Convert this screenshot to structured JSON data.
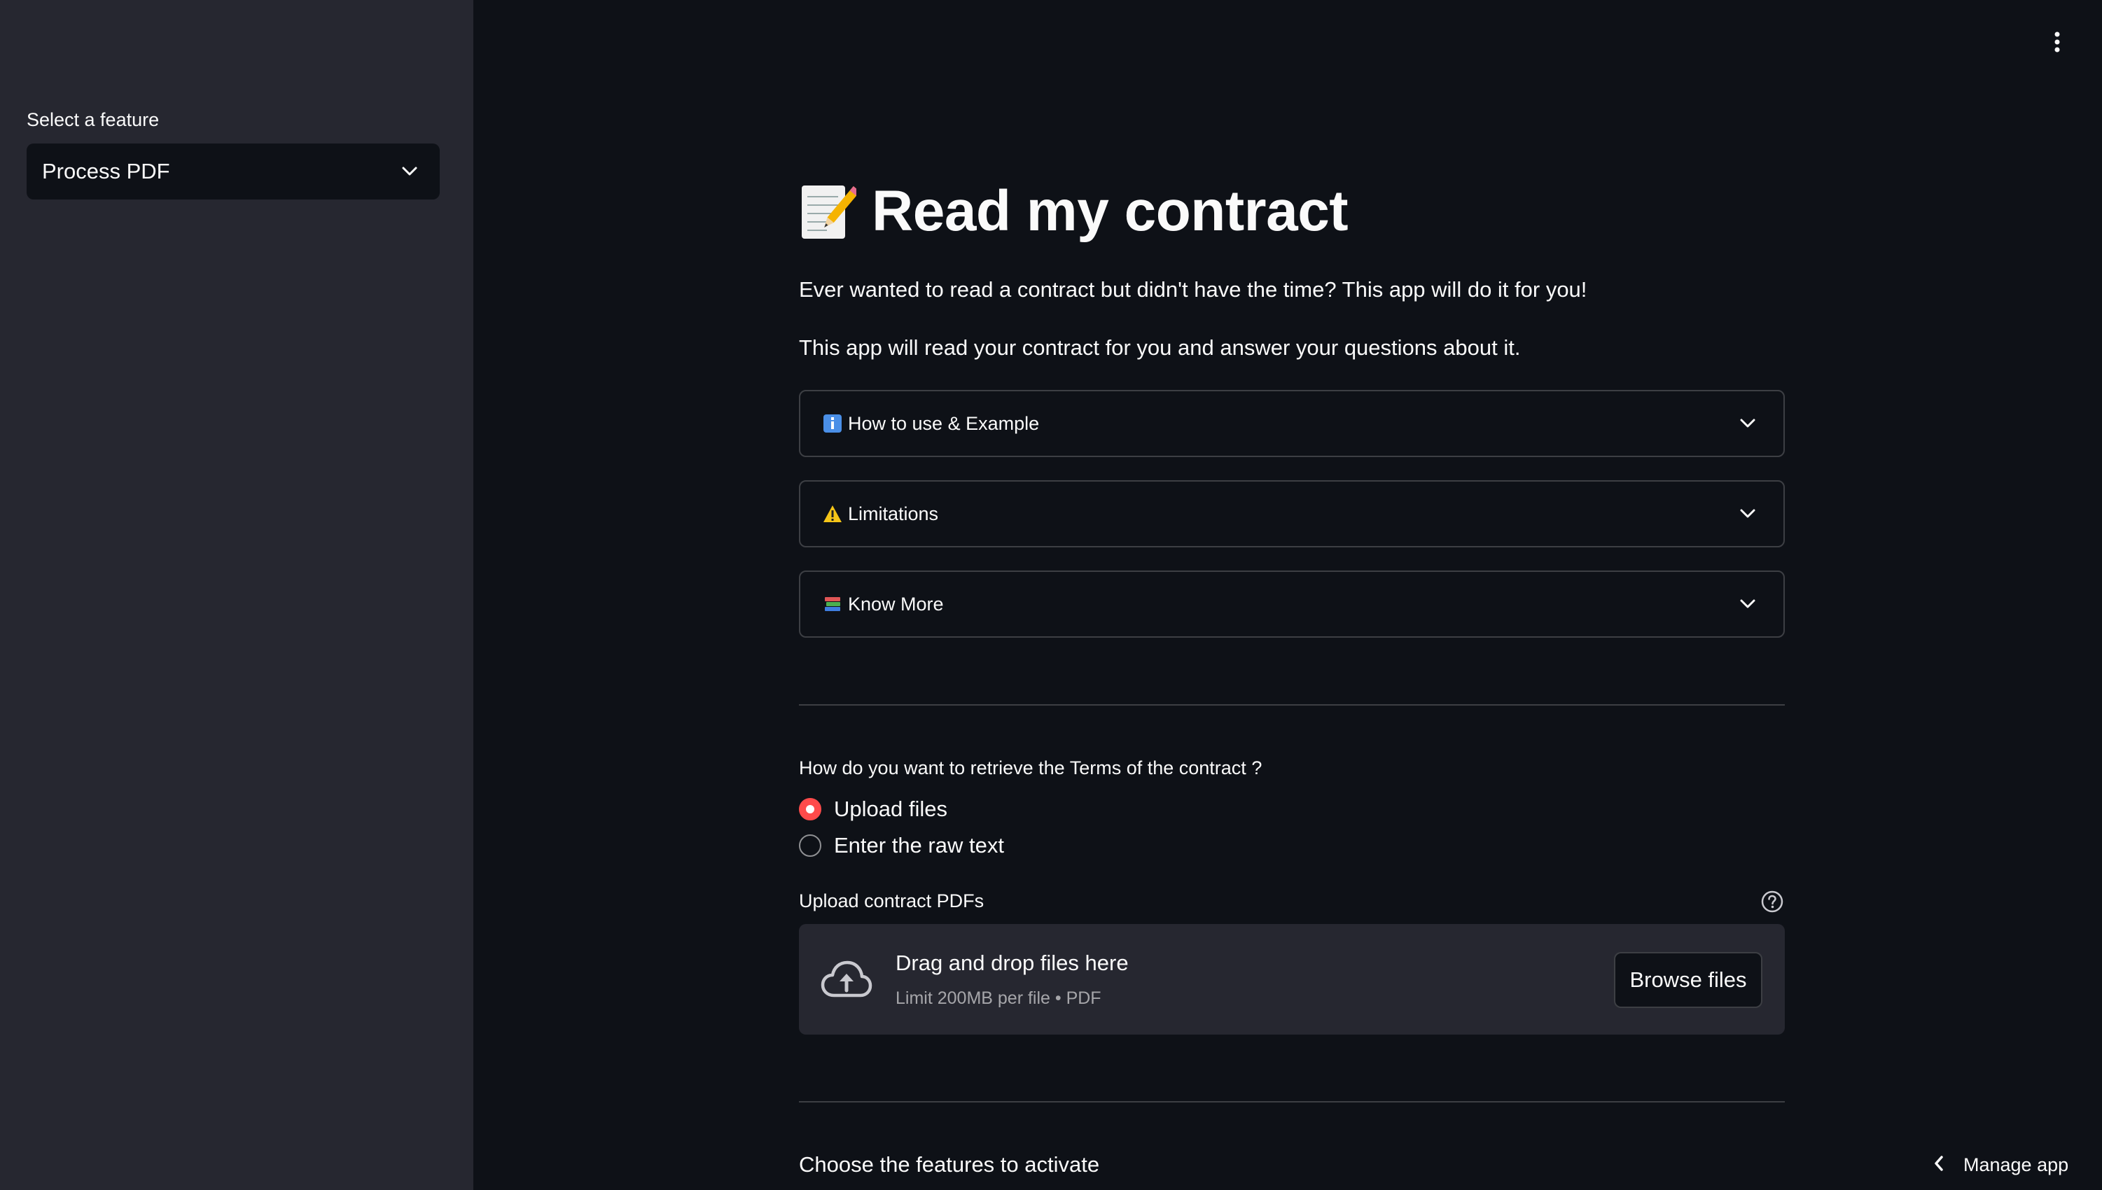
{
  "sidebar": {
    "select_label": "Select a feature",
    "select_value": "Process PDF"
  },
  "main": {
    "title": "Read my contract",
    "title_icon": "memo-icon",
    "intro_1": "Ever wanted to read a contract but didn't have the time? This app will do it for you!",
    "intro_2": "This app will read your contract for you and answer your questions about it.",
    "expanders": [
      {
        "label": "How to use & Example",
        "icon": "info-icon"
      },
      {
        "label": "Limitations",
        "icon": "warning-icon"
      },
      {
        "label": "Know More",
        "icon": "books-icon"
      }
    ],
    "retrieval_question": "How do you want to retrieve the Terms of the contract ?",
    "radio_options": [
      {
        "label": "Upload files",
        "selected": true
      },
      {
        "label": "Enter the raw text",
        "selected": false
      }
    ],
    "uploader": {
      "label": "Upload contract PDFs",
      "drop_title": "Drag and drop files here",
      "drop_subtitle": "Limit 200MB per file • PDF",
      "browse_label": "Browse files"
    },
    "features_heading": "Choose the features to activate"
  },
  "footer": {
    "manage_label": "Manage app"
  },
  "colors": {
    "background": "#0e1117",
    "sidebar": "#262730",
    "accent": "#ff4b4b",
    "text": "#fafafa"
  }
}
